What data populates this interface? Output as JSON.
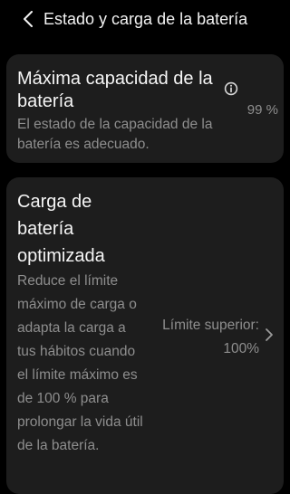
{
  "header": {
    "title": "Estado y carga de la batería"
  },
  "capacity_card": {
    "title": "Máxima capacidad de la batería",
    "description": "El estado de la capacidad de la batería es adecuado.",
    "value": "99 %"
  },
  "optimized_card": {
    "title": "Carga de batería optimizada",
    "description": "Reduce el límite máximo de carga o adapta la carga a tus hábitos cuando el límite máximo es de 100 % para prolongar la vida útil de la batería.",
    "value": "Límite superior: 100%"
  },
  "icons": {
    "back": "back-arrow-icon",
    "info": "info-icon",
    "chevron": "chevron-right-icon"
  },
  "colors": {
    "background": "#000000",
    "card": "#1d1d1d",
    "primary_text": "#f5f5f5",
    "secondary_text": "#8e8e8e"
  }
}
